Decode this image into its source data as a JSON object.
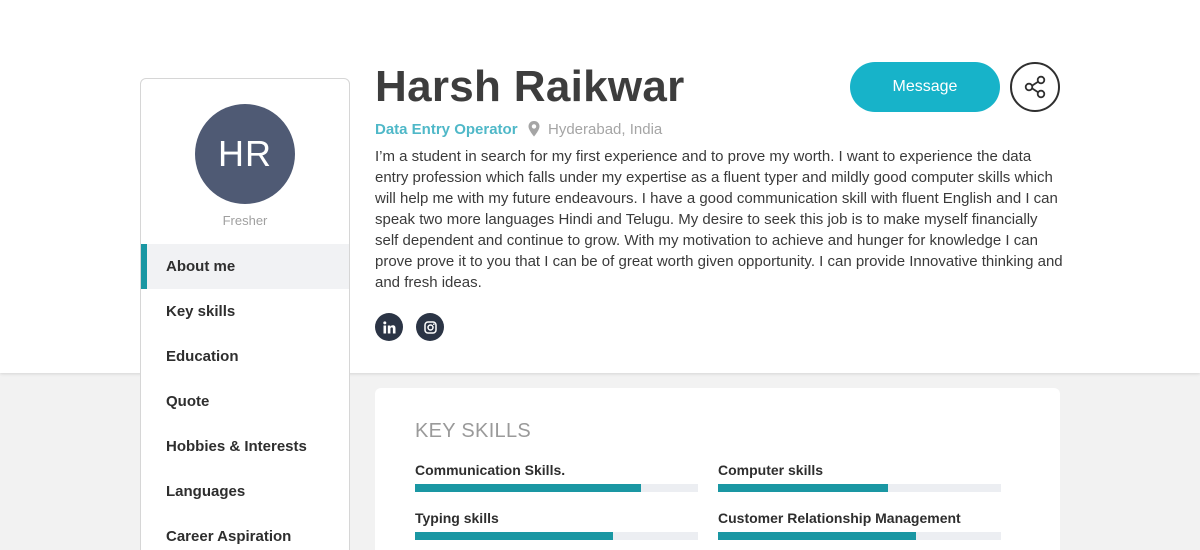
{
  "profile": {
    "initials": "HR",
    "status": "Fresher",
    "name": "Harsh Raikwar",
    "job_title": "Data Entry Operator",
    "location": "Hyderabad, India",
    "bio": "I’m a student in search for my first experience and to prove my worth. I want to experience the data entry profession which falls under my expertise as a fluent typer and mildly good computer skills which will help me with my future endeavours. I have a good communication skill with fluent English and I can speak two more languages Hindi and Telugu. My desire to seek this job is to make myself financially self dependent and continue to grow. With my motivation to achieve and hunger for knowledge I can prove prove it to you that I can be of great worth given opportunity. I can provide Innovative thinking and and fresh ideas."
  },
  "actions": {
    "message_label": "Message",
    "share_icon": "share-icon"
  },
  "social": [
    {
      "icon": "linkedin-icon"
    },
    {
      "icon": "instagram-icon"
    }
  ],
  "nav": {
    "items": [
      {
        "label": "About me",
        "active": true
      },
      {
        "label": "Key skills"
      },
      {
        "label": "Education"
      },
      {
        "label": "Quote"
      },
      {
        "label": "Hobbies & Interests"
      },
      {
        "label": "Languages"
      },
      {
        "label": "Career Aspiration"
      }
    ]
  },
  "skills": {
    "title": "KEY SKILLS",
    "items": [
      {
        "label": "Communication Skills.",
        "level": 0.8
      },
      {
        "label": "Computer skills",
        "level": 0.6
      },
      {
        "label": "Typing skills",
        "level": 0.7
      },
      {
        "label": "Customer Relationship Management",
        "level": 0.7
      }
    ]
  },
  "colors": {
    "accent": "#1a97a3",
    "message_button": "#17b3c9",
    "avatar": "#4f5a74",
    "job_title": "#4fb8c8"
  }
}
